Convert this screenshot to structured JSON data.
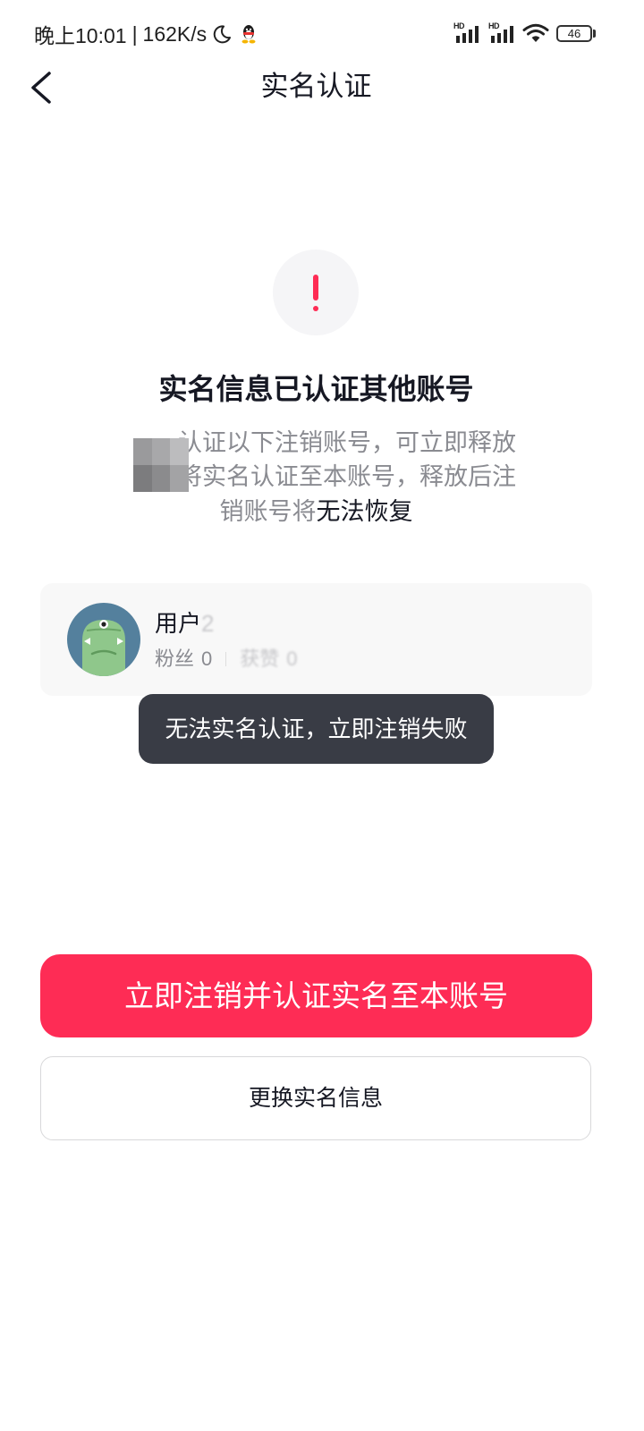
{
  "status_bar": {
    "time": "晚上10:01",
    "separator": "|",
    "speed": "162K/s",
    "sim1_label": "HD",
    "sim2_label": "HD",
    "battery_level": "46",
    "icons": [
      "moon-icon",
      "qq-icon",
      "signal-icon",
      "signal-icon",
      "wifi-icon",
      "battery-icon"
    ]
  },
  "nav": {
    "title": "实名认证",
    "back_icon": "chevron-left-icon"
  },
  "notice": {
    "icon": "exclamation-icon",
    "title": "实名信息已认证其他账号",
    "description_lines": [
      "认证以下注销账号，可立即释放",
      "将实名认证至本账号，释放后注"
    ],
    "description_last_prefix": "销账号将",
    "description_last_emphasis": "无法恢复"
  },
  "account_card": {
    "name": "用户",
    "name_obscured": "2",
    "stats": [
      {
        "label": "粉丝",
        "value": "0"
      },
      {
        "label": "获赞",
        "value": "0"
      }
    ]
  },
  "toast": {
    "message": "无法实名认证，立即注销失败"
  },
  "actions": {
    "primary_label": "立即注销并认证实名至本账号",
    "secondary_label": "更换实名信息"
  },
  "colors": {
    "accent": "#fe2c55",
    "toast_background": "#393c45",
    "text_primary": "#161823",
    "text_secondary": "#8a8b91",
    "avatar_background": "#54809d"
  }
}
